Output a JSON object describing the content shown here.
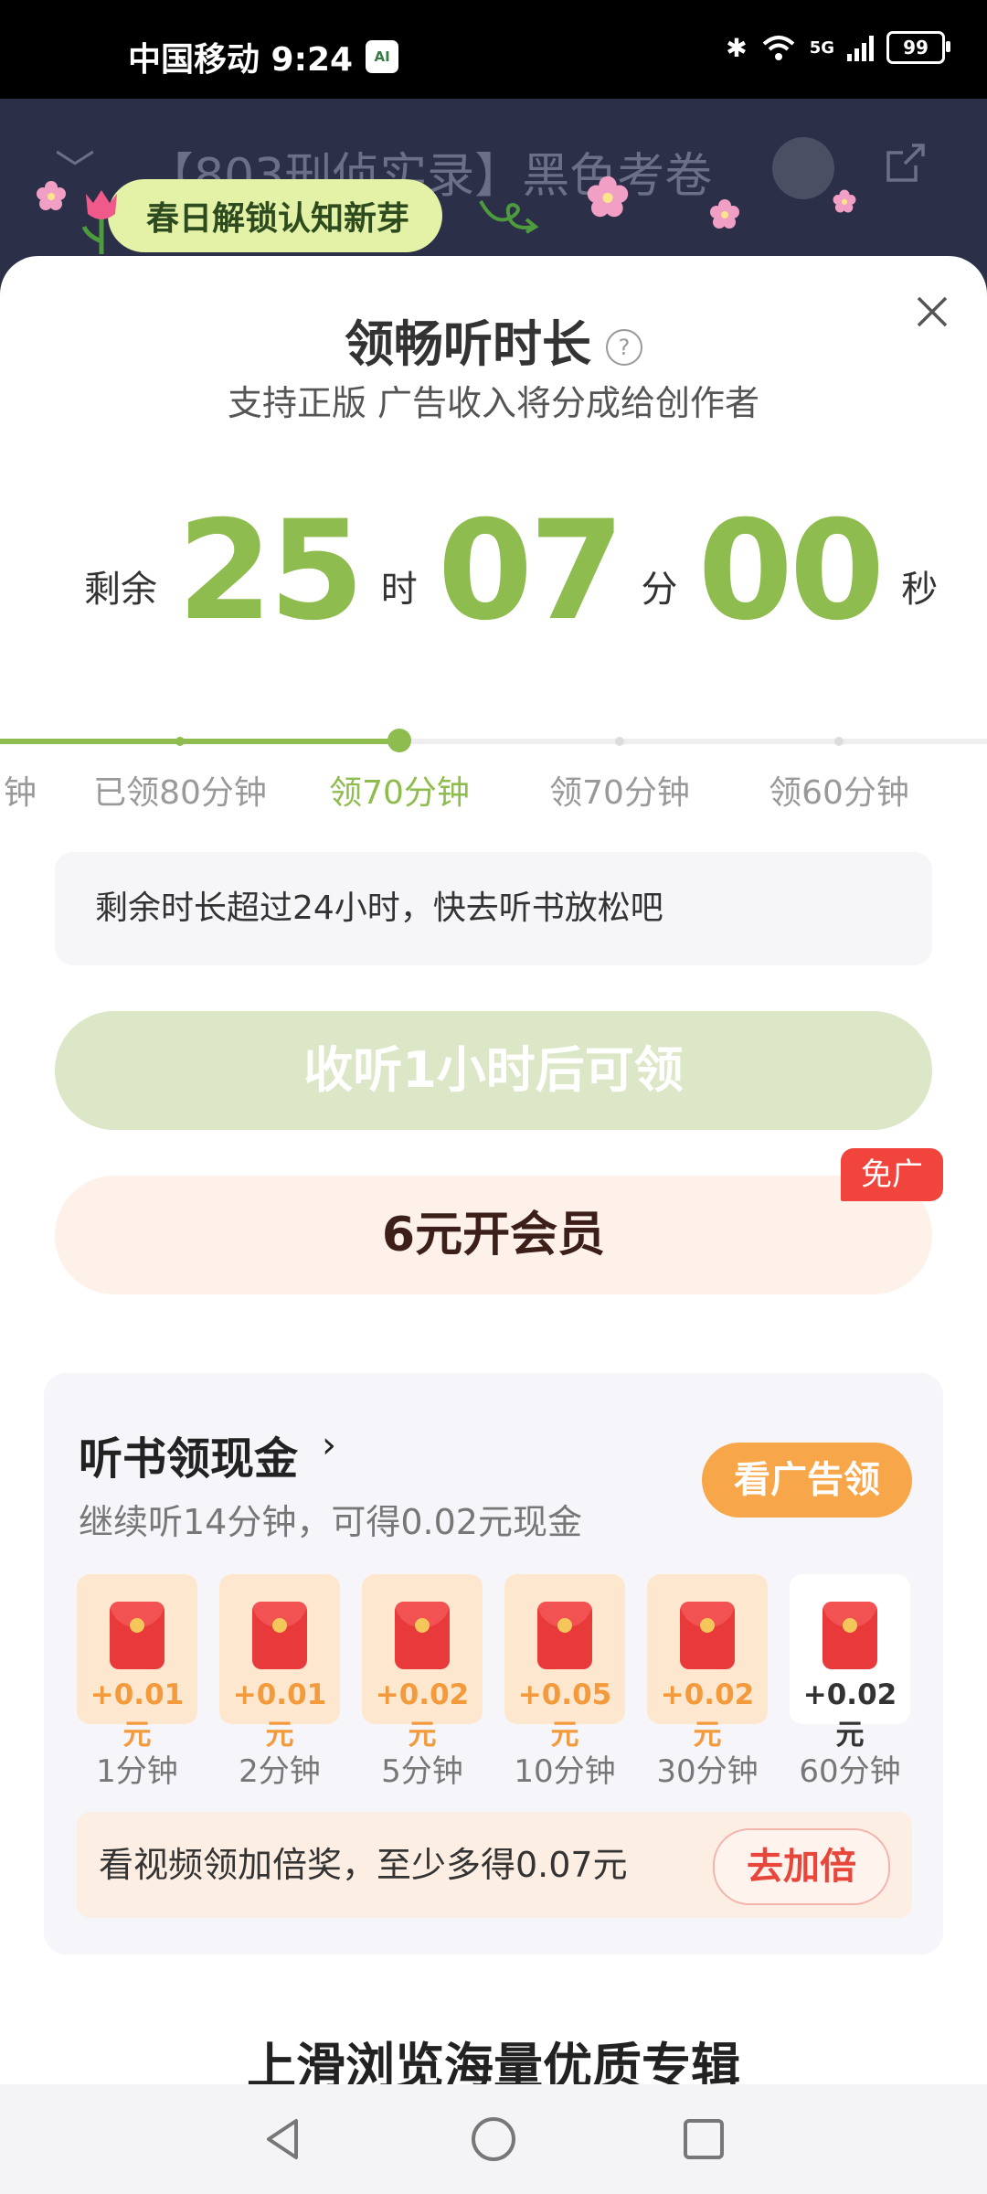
{
  "status_bar": {
    "carrier_time": "中国移动 9:24",
    "app_badge": "AI",
    "network": "5G",
    "battery": "99"
  },
  "header": {
    "title": "【803刑侦实录】黑色考卷",
    "banner_text": "春日解锁认知新芽"
  },
  "sheet": {
    "title": "领畅听时长",
    "help_symbol": "?",
    "subtitle": "支持正版 广告收入将分成给创作者",
    "timer": {
      "prefix": "剩余",
      "hours": "25",
      "hours_unit": "时",
      "minutes": "07",
      "minutes_unit": "分",
      "seconds": "00",
      "seconds_unit": "秒"
    },
    "steps": [
      "钟",
      "已领80分钟",
      "领70分钟",
      "领70分钟",
      "领60分钟"
    ],
    "notice": "剩余时长超过24小时，快去听书放松吧",
    "listen_button": "收听1小时后可领",
    "vip_button": "6元开会员",
    "ad_free_badge": "免广"
  },
  "cash": {
    "title": "听书领现金",
    "title_arrow": "›",
    "subtitle": "继续听14分钟，可得0.02元现金",
    "watch_ad_button": "看广告领",
    "rewards": [
      {
        "amount": "+0.01元",
        "time": "1分钟"
      },
      {
        "amount": "+0.01元",
        "time": "2分钟"
      },
      {
        "amount": "+0.02元",
        "time": "5分钟"
      },
      {
        "amount": "+0.05元",
        "time": "10分钟"
      },
      {
        "amount": "+0.02元",
        "time": "30分钟"
      },
      {
        "amount": "+0.02元",
        "time": "60分钟"
      }
    ],
    "double_text": "看视频领加倍奖，至少多得0.07元",
    "double_button": "去加倍"
  },
  "browse_text": "上滑浏览海量优质专辑",
  "colors": {
    "accent_green": "#8fbc4e",
    "orange": "#f8a64a",
    "red": "#e8463a"
  }
}
